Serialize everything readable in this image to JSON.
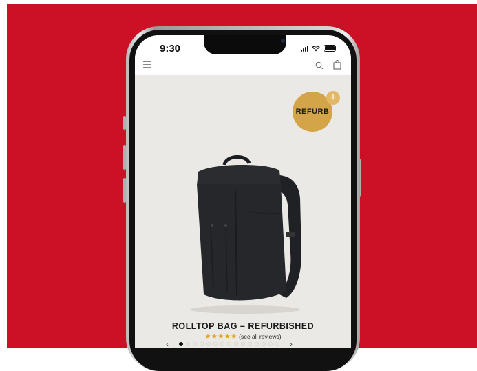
{
  "status_bar": {
    "time": "9:30"
  },
  "badge": {
    "label": "REFURB",
    "plus": "+"
  },
  "product": {
    "title": "ROLLTOP BAG – REFURBISHED",
    "stars": "★★★★★",
    "reviews_link": "(see all reviews)"
  },
  "carousel": {
    "prev": "‹",
    "next": "›",
    "dot_count": 15,
    "active_index": 0
  },
  "colors": {
    "background": "#cc1126",
    "badge": "#d4a448",
    "stars": "#e0a526",
    "product_bg": "#ebe9e5"
  }
}
